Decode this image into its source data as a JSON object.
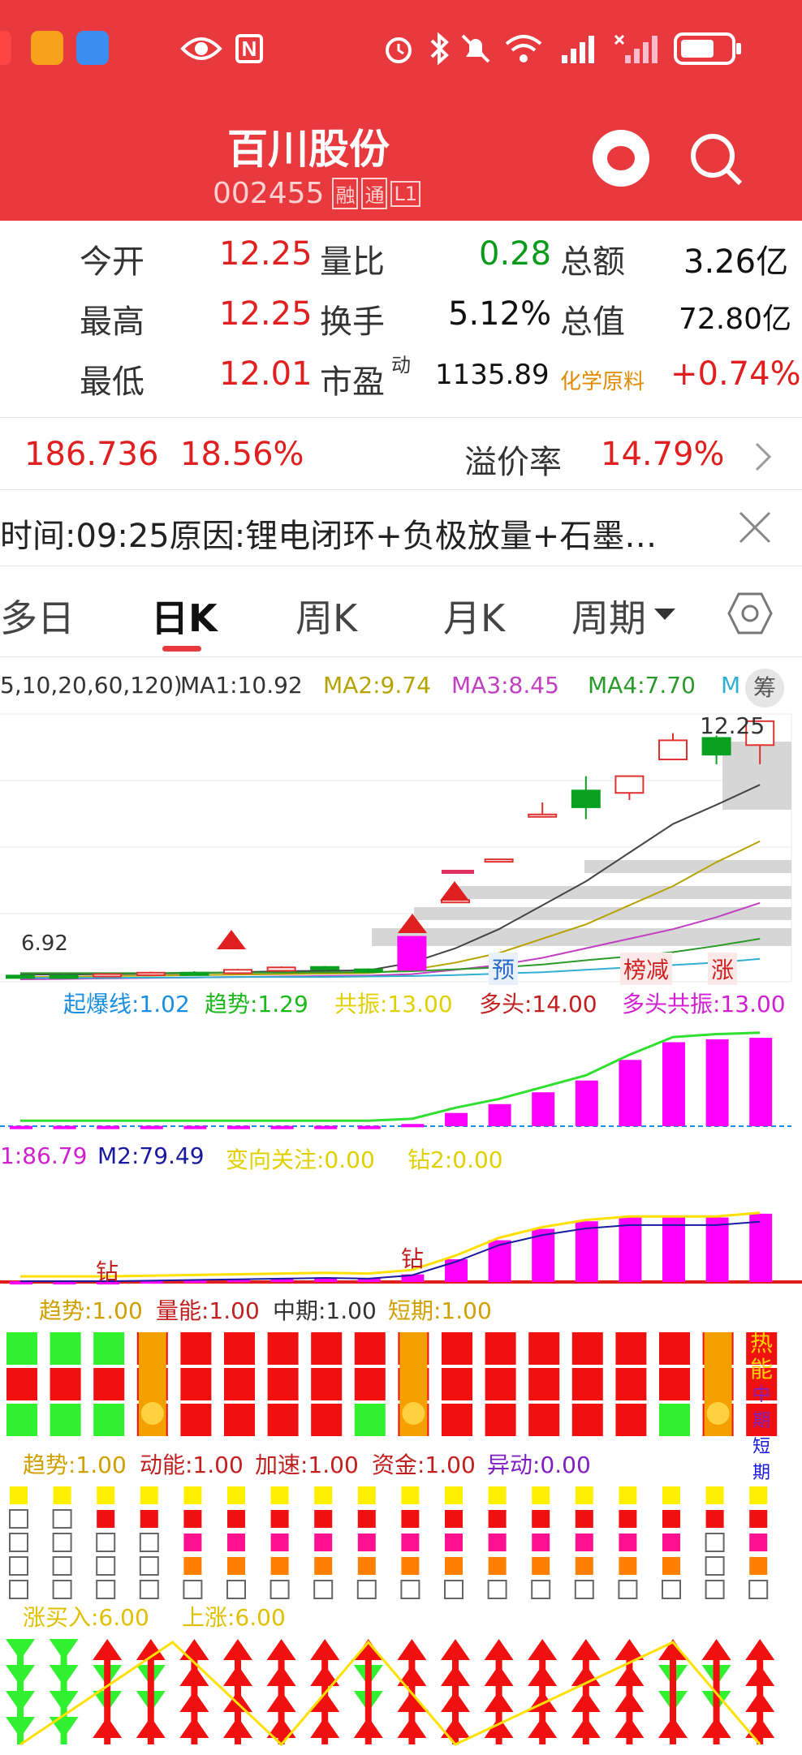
{
  "status": {
    "icons": [
      "app-icon-1",
      "app-icon-2",
      "app-icon-3",
      "eye-icon",
      "nfc-icon",
      "alarm-icon",
      "bluetooth-icon",
      "mute-icon",
      "wifi-icon",
      "signal-icon",
      "signal-off-icon",
      "battery-icon"
    ]
  },
  "header": {
    "title": "百川股份",
    "code": "002455",
    "badges": [
      "融",
      "通",
      "L1"
    ]
  },
  "quote": {
    "rows": [
      {
        "l1": "今开",
        "v1": "12.25",
        "l2": "量比",
        "v2": "0.28",
        "l3": "总额",
        "v3": "3.26亿"
      },
      {
        "l1": "最高",
        "v1": "12.25",
        "l2": "换手",
        "v2": "5.12%",
        "l3": "总值",
        "v3": "72.80亿"
      },
      {
        "l1": "最低",
        "v1": "12.01",
        "l2": "市盈",
        "l2sup": "动",
        "v2": "1135.89",
        "l3": "化学原料",
        "v3": "+0.74%"
      }
    ]
  },
  "conv": {
    "v1": "186.736",
    "v2": "18.56%",
    "label": "溢价率",
    "v3": "14.79%"
  },
  "notice": {
    "text": "时间:09:25原因:锂电闭环+负极放量+石墨…"
  },
  "tabs": {
    "items": [
      "多日",
      "日K",
      "周K",
      "月K",
      "周期"
    ],
    "active": "日K"
  },
  "ma": {
    "params": "5,10,20,60,120)",
    "ma1": "MA1:10.92",
    "ma2": "MA2:9.74",
    "ma3": "MA3:8.45",
    "ma4": "MA4:7.70",
    "ma5": "M",
    "chip": "筹"
  },
  "kline": {
    "high_label": "12.25",
    "low_label": "6.92",
    "tags": [
      "预",
      "榜减",
      "涨"
    ]
  },
  "ind1": {
    "a": "起爆线:1.02",
    "b": "趋势:1.29",
    "c": "共振:13.00",
    "d": "多头:14.00",
    "e": "多头共振:13.00"
  },
  "ind2": {
    "a": "1:86.79",
    "b": "M2:79.49",
    "c": "变向关注:0.00",
    "d": "钻2:0.00",
    "mark": "钻"
  },
  "ind3": {
    "a": "趋势:1.00",
    "b": "量能:1.00",
    "c": "中期:1.00",
    "d": "短期:1.00",
    "side": [
      "热",
      "能",
      "中期",
      "短期"
    ]
  },
  "ind4": {
    "a": "趋势:1.00",
    "b": "动能:1.00",
    "c": "加速:1.00",
    "d": "资金:1.00",
    "e": "异动:0.00"
  },
  "ind5": {
    "a": "涨买入:6.00",
    "b": "上涨:6.00"
  },
  "chart_data": {
    "type": "candlestick",
    "candles": [
      {
        "o": 6.93,
        "c": 6.9,
        "h": 6.95,
        "l": 6.88
      },
      {
        "o": 6.93,
        "c": 6.9,
        "h": 6.95,
        "l": 6.88
      },
      {
        "o": 6.93,
        "c": 6.96,
        "h": 6.98,
        "l": 6.91
      },
      {
        "o": 6.96,
        "c": 6.99,
        "h": 7.01,
        "l": 6.94
      },
      {
        "o": 6.99,
        "c": 6.97,
        "h": 7.02,
        "l": 6.95
      },
      {
        "o": 6.98,
        "c": 7.05,
        "h": 7.07,
        "l": 6.96
      },
      {
        "o": 7.03,
        "c": 7.1,
        "h": 7.12,
        "l": 7.01
      },
      {
        "o": 7.11,
        "c": 7.06,
        "h": 7.13,
        "l": 7.03
      },
      {
        "o": 7.06,
        "c": 7.04,
        "h": 7.08,
        "l": 6.99
      },
      {
        "o": 7.05,
        "c": 7.74,
        "h": 7.74,
        "l": 7.05
      },
      {
        "o": 8.51,
        "c": 8.51,
        "h": 8.51,
        "l": 8.51
      },
      {
        "o": 9.36,
        "c": 9.36,
        "h": 9.36,
        "l": 9.36
      },
      {
        "o": 10.3,
        "c": 10.3,
        "h": 10.55,
        "l": 10.3
      },
      {
        "o": 10.8,
        "c": 10.45,
        "h": 11.1,
        "l": 10.2
      },
      {
        "o": 10.75,
        "c": 11.1,
        "h": 11.1,
        "l": 10.6
      },
      {
        "o": 11.45,
        "c": 11.85,
        "h": 12.0,
        "l": 11.45
      },
      {
        "o": 11.9,
        "c": 11.55,
        "h": 11.95,
        "l": 11.35
      },
      {
        "o": 11.75,
        "c": 12.25,
        "h": 12.25,
        "l": 11.35
      }
    ],
    "ylim": [
      6.8,
      12.4
    ],
    "ind1_values": [
      0.02,
      0.02,
      0.02,
      0.02,
      0.02,
      0.02,
      0.02,
      0.02,
      0.02,
      0.15,
      0.9,
      1.5,
      2.3,
      3.1,
      4.5,
      5.7,
      5.9,
      6.0,
      6.4
    ],
    "ind2_values": [
      0.01,
      0.01,
      0.01,
      0.02,
      0.03,
      0.04,
      0.05,
      0.06,
      0.05,
      0.1,
      0.3,
      0.55,
      0.7,
      0.8,
      0.85,
      0.85,
      0.85,
      0.9,
      1.0
    ],
    "ind4_pattern": [
      1,
      1,
      2,
      2,
      3,
      3,
      3,
      3,
      3,
      3,
      3,
      3,
      3,
      3,
      3,
      3,
      2,
      3,
      3
    ],
    "ind5_pattern": [
      "g",
      "g",
      "mix",
      "mix",
      "r",
      "r",
      "r",
      "r",
      "mix",
      "r",
      "r",
      "r",
      "r",
      "r",
      "r",
      "mix",
      "mix",
      "r"
    ]
  }
}
